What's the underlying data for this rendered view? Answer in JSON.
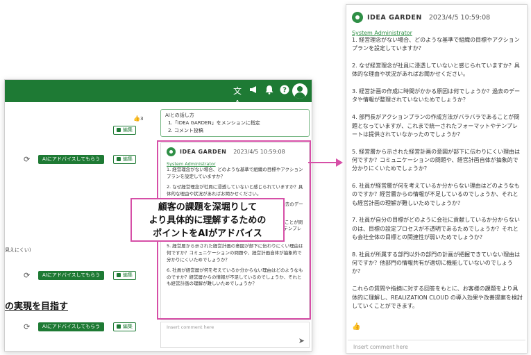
{
  "topbar": {
    "icons": [
      "translate-icon",
      "megaphone-icon",
      "bell-icon",
      "help-icon",
      "account-icon"
    ],
    "translate_glyph": "文A",
    "megaphone_glyph": "📢",
    "bell_glyph": "🔔",
    "help_glyph": "?"
  },
  "left": {
    "like_count": "3",
    "edit_label": "編集",
    "ai_button_label": "AIにアドバイスしてもらう",
    "side_note": "見えにくい)",
    "goal_heading": "の実現を目指す",
    "ai_tips": {
      "title": "AIとの話し方",
      "items": [
        "1.「IDEA GARDEN」をメンションに指定",
        "2. コメント投稿"
      ]
    },
    "comment_input_placeholder": "Insert comment here"
  },
  "comment": {
    "author": "IDEA GARDEN",
    "date": "2023/4/5 10:59:08",
    "mention": "System Administrator",
    "paragraphs": [
      "1. 経営理念がない場合、どのような基準で組織の目標やアクションプランを設定していますか？",
      "2. なぜ経営理念が社員に浸透していないと感じられていますか？具体的な理由や状況があればお聞かせください。",
      "3. 経営計画の作成に時間がかかる原因は何でしょうか？過去のデータや情報が整理されていないためでしょうか？",
      "4. 部門長がアクションプランの作成方法がバラバラであることが問題となっていますが、これまで統一されたフォーマットやテンプレートは提供されていなかったのでしょうか？",
      "5. 経営層から示された経営計画の意図が部下に伝わりにくい理由は何ですか？コミュニケーションの問題や、経営計画自体が抽象的で分かりにくいためでしょうか？",
      "6. 社員が経営層が何を考えているか分からない理由はどのようなものですか？経営層からの情報が不足しているのでしょうか、それとも経営計画の理解が難しいためでしょうか？",
      "7. 社員が自分の目標がどのように会社に貢献しているか分からないのは、目標の設定プロセスが不透明であるためでしょうか？それとも会社全体の目標との関連性が弱いためでしょうか？",
      "8. 社員が所属する部門以外の部門の計画が把握できていない理由は何ですか？他部門の情報共有が適切に機能していないのでしょうか？",
      "これらの質問や指摘に対する回答をもとに、お客様の課題をより具体的に理解し、REALIZATION CLOUD の導入効果や改善提案を検討していくことができます。"
    ]
  },
  "callout": {
    "lines": [
      "顧客の課題を深堀りして",
      "より具体的に理解するための",
      "ポイントをAIがアドバイス"
    ]
  },
  "right": {
    "like_glyph": "👍",
    "comment_input_placeholder": "Insert comment here"
  }
}
